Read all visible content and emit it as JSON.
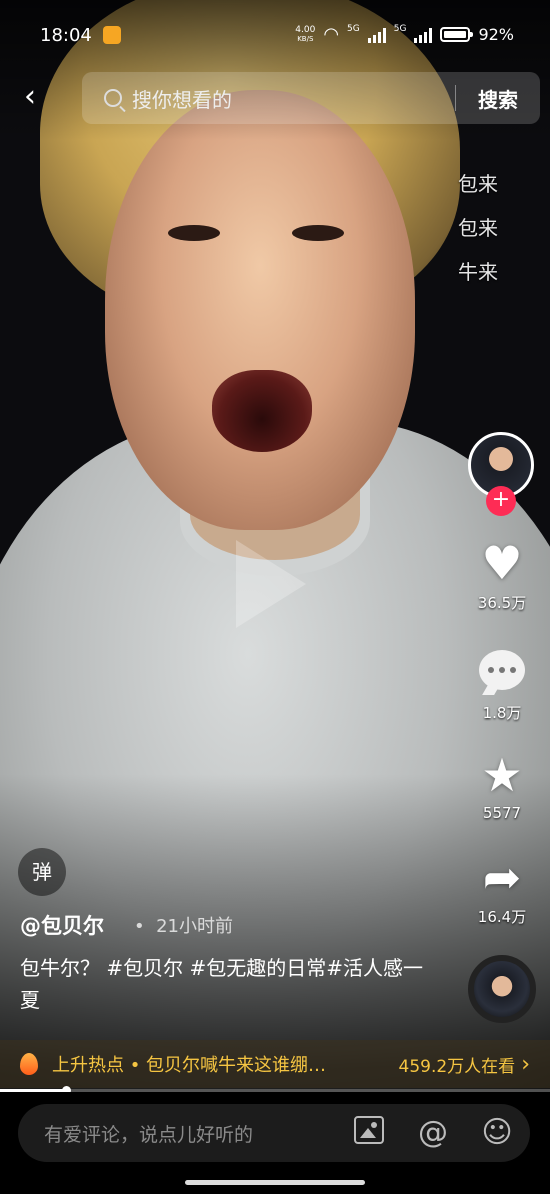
{
  "status_bar": {
    "time": "18:04",
    "net_speed": "4.00",
    "net_unit": "KB/S",
    "sim1": "5G",
    "sim2": "5G",
    "battery": "92%"
  },
  "search": {
    "placeholder": "搜你想看的",
    "button": "搜索"
  },
  "danmaku": [
    "包来",
    "包来",
    "牛来"
  ],
  "rail": {
    "likes": "36.5万",
    "comments": "1.8万",
    "favorites": "5577",
    "shares": "16.4万",
    "icons": {
      "follow": "plus-icon",
      "like": "heart-icon",
      "comment": "comment-icon",
      "favorite": "star-icon",
      "share": "share-icon"
    }
  },
  "danmaku_toggle": "弹",
  "post": {
    "author": "@包贝尔",
    "time_ago": "21小时前",
    "caption": "包牛尔？ #包贝尔 #包无趣的日常#活人感一夏"
  },
  "hot": {
    "text": "上升热点 • 包贝尔喊牛来这谁绷…",
    "viewers": "459.2万人在看"
  },
  "progress": 0.12,
  "comment_bar": {
    "placeholder": "有爱评论，说点儿好听的"
  },
  "colors": {
    "like_accent": "#fe2c55",
    "hot_text": "#f5c542"
  }
}
